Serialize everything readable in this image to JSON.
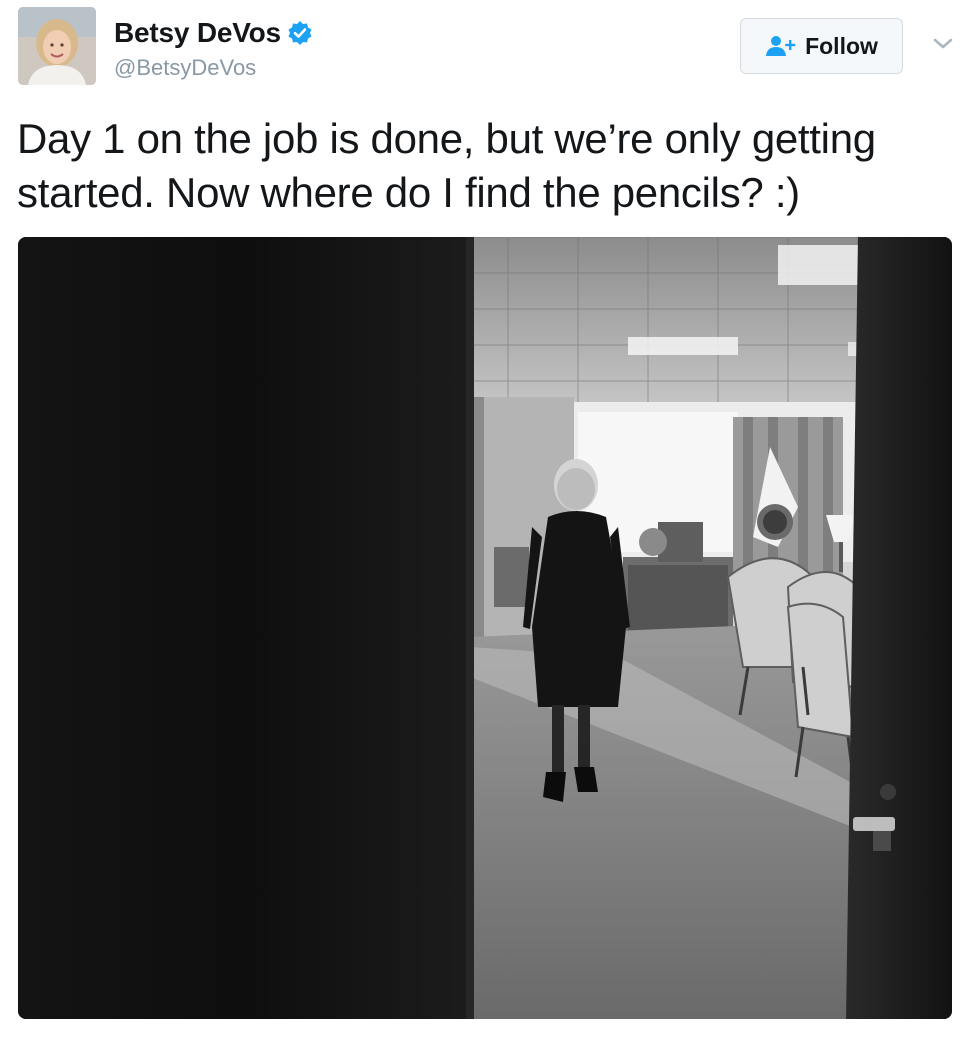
{
  "user": {
    "display_name": "Betsy DeVos",
    "handle": "@BetsyDeVos",
    "verified": true
  },
  "follow_button": {
    "label": "Follow",
    "icon": "add-user-icon"
  },
  "menu": {
    "icon": "chevron-down-icon"
  },
  "tweet": {
    "text_line1": "Day 1 on the job is done, but we’re only getting",
    "text_line2": "started. Now where do I find the pencils? :)"
  },
  "colors": {
    "verified_blue": "#1da1f2",
    "follow_icon_blue": "#1da1f2",
    "handle_gray": "#8899a6"
  }
}
